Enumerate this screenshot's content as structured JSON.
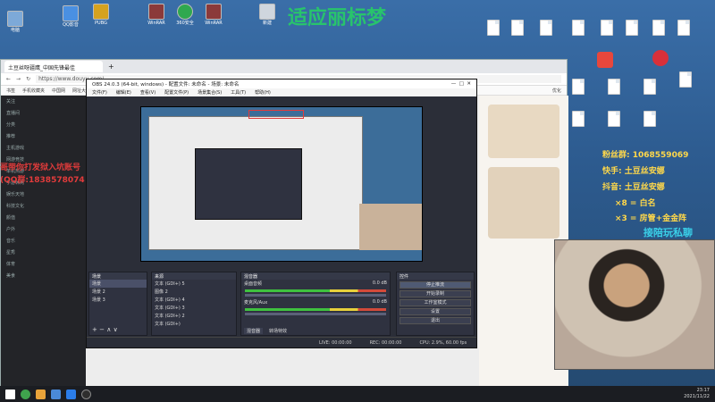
{
  "desktop": {
    "top_icons": [
      {
        "label": "电脑",
        "color": "#7da9d8"
      },
      {
        "label": "QQ影音",
        "color": "#4a90e2"
      },
      {
        "label": "PUBG",
        "color": "#d6a21e"
      },
      {
        "label": "WinRAR",
        "color": "#8b3a3a"
      },
      {
        "label": "360安全",
        "color": "#2fa84f"
      },
      {
        "label": "WinRAR",
        "color": "#8b3a3a"
      },
      {
        "label": "新建",
        "color": "#cfd6de"
      }
    ],
    "title_overlay": "适应丽标梦"
  },
  "browser": {
    "tab_title": "土豆丝呀疆鹰_中国先锋最佳",
    "address": "https://www.douyu.com/...",
    "bookmarks": [
      "书签",
      "手机收藏夹",
      "中国网",
      "网址大全"
    ],
    "bookmarks_right": "优化"
  },
  "site": {
    "left_items": [
      "关注",
      "直播间",
      "分类",
      "推荐",
      "主机游戏",
      "网游竞技",
      "单机热游",
      "手游休闲",
      "娱乐天地",
      "科技文化",
      "颜值",
      "户外",
      "音乐",
      "星秀",
      "体育",
      "美食"
    ],
    "red_overlay_line1": "哥带你打发狱入坑账号",
    "red_overlay_line2": "(QQ群:1838578074"
  },
  "obs": {
    "title": "OBS 24.0.3 (64-bit, windows) - 配置文件: 未命名 - 场景: 未命名",
    "menu": [
      "文件(F)",
      "编辑(E)",
      "查看(V)",
      "配置文件(P)",
      "场景集合(S)",
      "工具(T)",
      "帮助(H)"
    ],
    "scenes_header": "场景",
    "scenes": [
      "场景",
      "场景 2",
      "场景 3"
    ],
    "sources_header": "来源",
    "sources": [
      "文本 (GDI+) 5",
      "图像 2",
      "文本 (GDI+) 4",
      "文本 (GDI+) 3",
      "文本 (GDI+) 2",
      "文本 (GDI+)"
    ],
    "mixer_header": "混音器",
    "mixer_tracks": [
      {
        "name": "桌面音频",
        "db": "0.0 dB"
      },
      {
        "name": "麦克风/Aux",
        "db": "0.0 dB"
      }
    ],
    "mixer_tabs": [
      "混音器",
      "转场特效"
    ],
    "controls_header": "控件",
    "controls": [
      "停止推流",
      "开始录制",
      "工作室模式",
      "设置",
      "退出"
    ],
    "status": {
      "live": "LIVE: 00:00:00",
      "rec": "REC: 00:00:00",
      "cpu": "CPU: 2.9%, 60.00 fps"
    }
  },
  "stream_overlay": {
    "fans": "粉丝群: 1068559069",
    "kuaishou": "快手: 土豆丝安娜",
    "douyin": "抖音: 土豆丝安娜",
    "gift1": "×8 = 白名",
    "gift2": "×3 = 房管+金金阵",
    "call": "接陪玩私聊"
  },
  "taskbar": {
    "time": "23:17",
    "date": "2021/11/22"
  }
}
